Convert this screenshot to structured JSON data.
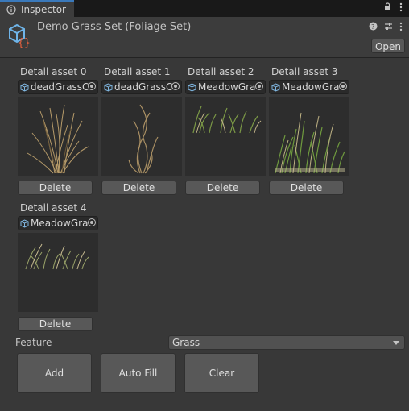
{
  "tab": {
    "label": "Inspector",
    "icon": "info-icon"
  },
  "tab_actions": [
    "lock-icon",
    "kebab-menu-icon"
  ],
  "header": {
    "title": "Demo Grass Set (Foliage Set)",
    "icons": [
      "help-icon",
      "settings-icon",
      "kebab-menu-icon"
    ],
    "open_label": "Open"
  },
  "details": [
    {
      "label": "Detail asset 0",
      "asset": "deadGrassC",
      "delete_label": "Delete",
      "thumb": "dead-grass-0"
    },
    {
      "label": "Detail asset 1",
      "asset": "deadGrassC",
      "delete_label": "Delete",
      "thumb": "dead-grass-1"
    },
    {
      "label": "Detail asset 2",
      "asset": "MeadowGra",
      "delete_label": "Delete",
      "thumb": "meadow-grass-2"
    },
    {
      "label": "Detail asset 3",
      "asset": "MeadowGra",
      "delete_label": "Delete",
      "thumb": "meadow-grass-3"
    },
    {
      "label": "Detail asset 4",
      "asset": "MeadowGra",
      "delete_label": "Delete",
      "thumb": "meadow-grass-4"
    }
  ],
  "feature": {
    "label": "Feature",
    "value": "Grass"
  },
  "actions": {
    "add": "Add",
    "auto_fill": "Auto Fill",
    "clear": "Clear"
  },
  "colors": {
    "background": "#383838",
    "tab_accent": "#3a79bb",
    "button": "#585858",
    "thumb_bg": "#2d2d2d"
  }
}
